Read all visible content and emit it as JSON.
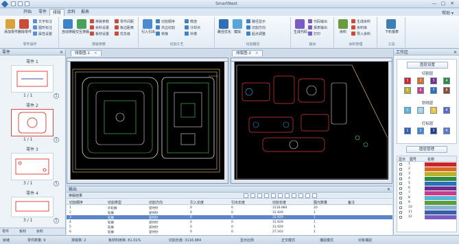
{
  "window": {
    "title": "SmartNest",
    "controls": [
      "—",
      "▢",
      "✕"
    ]
  },
  "menu": {
    "tabs": [
      {
        "label": "开始",
        "active": false
      },
      {
        "label": "零件",
        "active": false
      },
      {
        "label": "排版",
        "active": true
      },
      {
        "label": "余料",
        "active": false
      },
      {
        "label": "报表",
        "active": false
      }
    ],
    "right_label": "帮助 ▾"
  },
  "ribbon": {
    "groups": [
      {
        "label": "零件操作",
        "big": [
          {
            "label": "添加零件",
            "color": "#d9a23a"
          },
          {
            "label": "删除零件",
            "color": "#c84d3a"
          }
        ],
        "small": [
          "文字标注",
          "图形标注",
          "属性设置"
        ]
      },
      {
        "label": "排版参数",
        "big": [
          {
            "label": "自动排版",
            "color": "#3f82c8"
          },
          {
            "label": "交互排版",
            "color": "#4aa05a"
          }
        ],
        "small": [
          "排版参数",
          "余料设置",
          "板材设置",
          "零件间距",
          "板边距离",
          "优先级"
        ]
      },
      {
        "label": "切割工艺",
        "big": [
          {
            "label": "引入引出",
            "color": "#4b8bd0"
          }
        ],
        "small": [
          "切割顺序",
          "共边切割",
          "桥接",
          "微连",
          "冷却点",
          "补偿"
        ]
      },
      {
        "label": "切割路径",
        "big": [
          {
            "label": "路径优化",
            "color": "#2e6fb6"
          },
          {
            "label": "模拟",
            "color": "#56a6d8"
          }
        ],
        "small": [
          "路径显示",
          "切割方向",
          "起点调整"
        ]
      },
      {
        "label": "输出",
        "big": [
          {
            "label": "生成代码",
            "color": "#7a5cc2"
          }
        ],
        "small": [
          "代码输出",
          "报表输出",
          "打印"
        ]
      },
      {
        "label": "余料管理",
        "big": [
          {
            "label": "余料",
            "color": "#6a9b3e"
          }
        ],
        "small": [
          "生成余料",
          "余料库",
          "导入余料"
        ]
      },
      {
        "label": "工具",
        "big": [
          {
            "label": "下料报表",
            "color": "#3d7fb3"
          }
        ],
        "small": []
      }
    ]
  },
  "left_panel": {
    "title": "零件",
    "parts": [
      {
        "name": "零件 1",
        "count": "1 / 1",
        "badge": "1",
        "selected": false
      },
      {
        "name": "零件 2",
        "count": "1 / 1",
        "badge": "1",
        "selected": true
      },
      {
        "name": "零件 3",
        "count": "3 / 1",
        "badge": "1",
        "selected": false
      },
      {
        "name": "零件 4",
        "count": "3 / 1",
        "badge": "1",
        "selected": false
      }
    ],
    "footer_tabs": [
      "零件",
      "板材",
      "余料"
    ]
  },
  "drawing": {
    "tabs": [
      {
        "label": "排版图-1"
      },
      {
        "label": "排版图-2"
      }
    ]
  },
  "right_panel": {
    "title": "工作区",
    "top_button": "图层设置",
    "sections": [
      {
        "label": "切割层",
        "colors": [
          "#c8262c",
          "#d96a1f",
          "#6b2f8f",
          "#2d8a3e",
          "#b8b02a",
          "#c83a8a",
          "#2c6fbf",
          "#8a4b24"
        ]
      },
      {
        "label": "划线层",
        "colors": [
          "#58b3d8",
          "#9ad0e5",
          "#e6c23a",
          "#5c68c6"
        ]
      },
      {
        "label": "打标层",
        "colors": [
          "#2f5fb5",
          "#3d86d0",
          "#1e3f8f",
          "#5a78c8"
        ]
      }
    ],
    "bottom_button": "图层管理",
    "layer_table": {
      "headers": [
        "显示",
        "图号",
        "名称"
      ],
      "rows": [
        {
          "num": "1",
          "color": "#c8262c"
        },
        {
          "num": "2",
          "color": "#d96a1f"
        },
        {
          "num": "3",
          "color": "#b8b02a"
        },
        {
          "num": "4",
          "color": "#2d8a3e"
        },
        {
          "num": "5",
          "color": "#2c6fbf"
        },
        {
          "num": "6",
          "color": "#6b2f8f"
        },
        {
          "num": "7",
          "color": "#c83a8a"
        },
        {
          "num": "8",
          "color": "#58b3d8"
        },
        {
          "num": "9",
          "color": "#5a9e3a"
        },
        {
          "num": "10",
          "color": "#8fb3d5"
        },
        {
          "num": "11",
          "color": "#3d5fa8"
        },
        {
          "num": "12",
          "color": "#7a5cc2"
        }
      ]
    }
  },
  "output_panel": {
    "title": "输出",
    "subtitle": "排版结果",
    "table": {
      "headers": [
        "切割顺序",
        "切割类型",
        "切割方向",
        "引入长度",
        "引出长度",
        "切割长度",
        "图元数量",
        "备注"
      ],
      "rows": [
        {
          "cells": [
            "1",
            "外轮廓",
            "逆时针",
            "0",
            "0",
            "3116.984",
            "20",
            ""
          ],
          "selected": false
        },
        {
          "cells": [
            "2",
            "轮廓",
            "逆时针",
            "0",
            "0",
            "31.929",
            "1",
            ""
          ],
          "selected": false
        },
        {
          "cells": [
            "3",
            "轮廓",
            "逆时针",
            "0",
            "0",
            "31.929",
            "1",
            ""
          ],
          "selected": true
        },
        {
          "cells": [
            "4",
            "轮廓",
            "逆时针",
            "0",
            "0",
            "31.929",
            "1",
            ""
          ],
          "selected": false
        },
        {
          "cells": [
            "5",
            "轮廓",
            "逆时针",
            "0",
            "0",
            "31.929",
            "1",
            ""
          ],
          "selected": false
        },
        {
          "cells": [
            "6",
            "轮廓",
            "逆时针",
            "0",
            "0",
            "27.163",
            "1",
            ""
          ],
          "selected": false
        }
      ]
    }
  },
  "status_bar": {
    "items": [
      "就绪",
      "零件数量: 9",
      "排版数: 2",
      "板材利用率: 81.01%",
      "切割长度: 3116.984",
      "显示比例",
      "正交模式",
      "捕捉模式",
      "对象捕捉"
    ]
  }
}
